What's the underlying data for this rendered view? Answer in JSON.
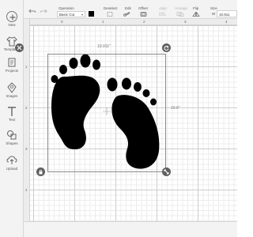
{
  "sidebar": {
    "items": [
      {
        "label": "New",
        "icon": "plus-icon"
      },
      {
        "label": "Templates",
        "icon": "shirt-icon"
      },
      {
        "label": "Projects",
        "icon": "projects-icon"
      },
      {
        "label": "Images",
        "icon": "image-icon"
      },
      {
        "label": "Text",
        "icon": "text-icon"
      },
      {
        "label": "Shapes",
        "icon": "shapes-icon"
      },
      {
        "label": "Upload",
        "icon": "upload-icon"
      }
    ]
  },
  "toolbar": {
    "operation_label": "Operation",
    "operation_value": "Basic Cut",
    "swatch_color": "#000000",
    "deselect_label": "Deselect",
    "edit_label": "Edit",
    "offset_label": "Offset",
    "align_label": "Align",
    "arrange_label": "Arrange",
    "flip_label": "Flip",
    "size_label": "Size",
    "size_w_label": "W",
    "size_w_value": "10.911"
  },
  "rulers": {
    "top": [
      "0",
      "1",
      "2",
      "3",
      "4"
    ],
    "left": [
      "1",
      "2",
      "3",
      "4"
    ]
  },
  "selection": {
    "width_label": "10.911\"",
    "height_label": "10.6\""
  },
  "colors": {
    "accent": "#606060",
    "artwork": "#000000"
  }
}
